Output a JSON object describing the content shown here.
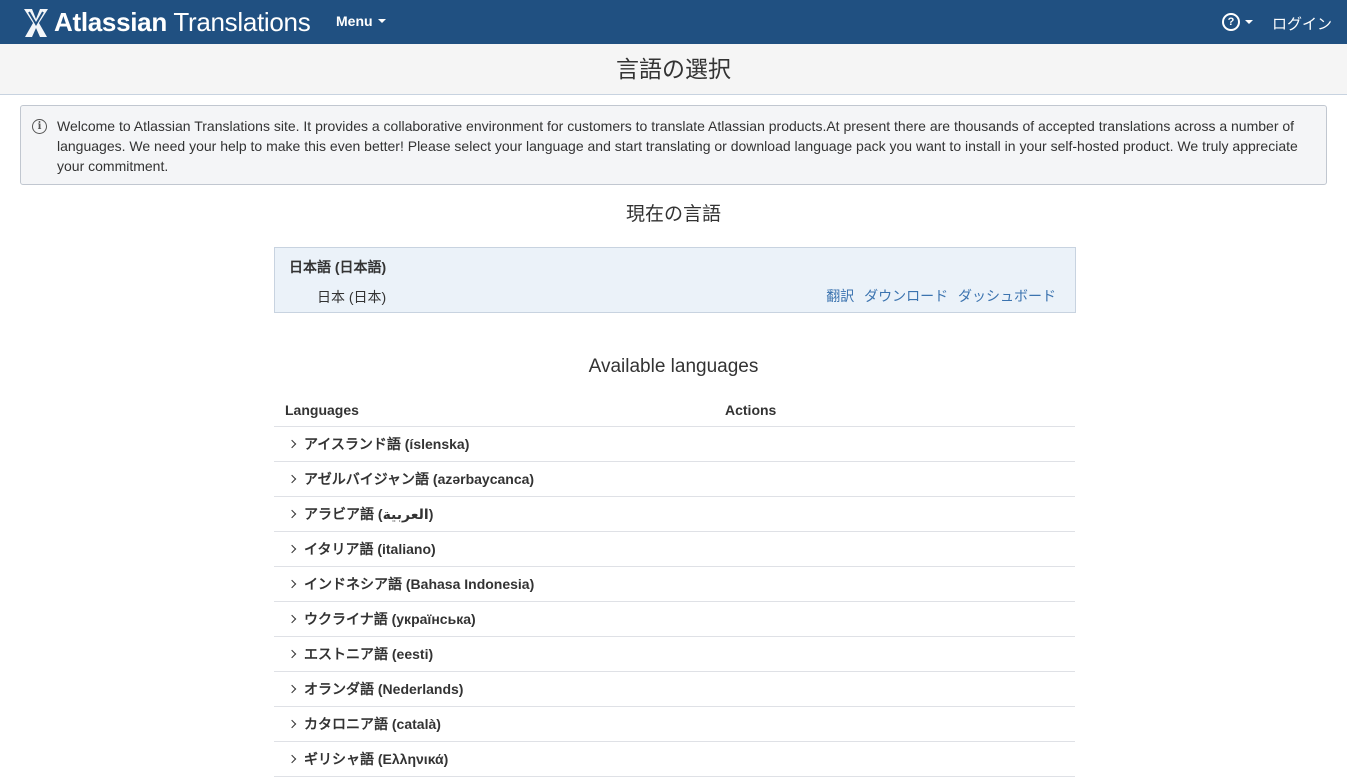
{
  "header": {
    "brand_bold": "Atlassian",
    "brand_light": " Translations",
    "menu_label": "Menu",
    "help_glyph": "?",
    "login_label": "ログイン",
    "bg_color": "#205081"
  },
  "page": {
    "title": "言語の選択"
  },
  "info": {
    "icon": "info-icon",
    "message": "Welcome to Atlassian Translations site. It provides a collaborative environment for customers to translate Atlassian products.At present there are thousands of accepted translations across a number of languages. We need your help to make this even better! Please select your language and start translating or download language pack you want to install in your self-hosted product. We truly appreciate your commitment."
  },
  "current": {
    "heading": "現在の言語",
    "language": "日本語 (日本語)",
    "locale": "日本 (日本)",
    "actions": [
      "翻訳",
      "ダウンロード",
      "ダッシュボード"
    ]
  },
  "available": {
    "heading": "Available languages",
    "columns": [
      "Languages",
      "Actions"
    ],
    "rows": [
      "アイスランド語 (íslenska)",
      "アゼルバイジャン語 (azərbaycanca)",
      "アラビア語 (العربية)",
      "イタリア語 (italiano)",
      "インドネシア語 (Bahasa Indonesia)",
      "ウクライナ語 (українська)",
      "エストニア語 (eesti)",
      "オランダ語 (Nederlands)",
      "カタロニア語 (català)",
      "ギリシャ語 (Ελληνικά)"
    ]
  }
}
